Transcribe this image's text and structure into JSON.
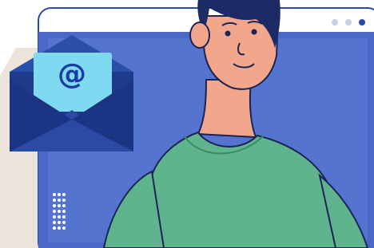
{
  "illustration": {
    "envelope_symbol": "@",
    "window_dots": 3,
    "decor_dot_rows": 7,
    "decor_dot_cols": 3
  },
  "colors": {
    "background": "#ffffff",
    "beige_panel": "#ece4da",
    "window_border": "#2d49a8",
    "window_fill": "#4a68c6",
    "window_dot_light": "#c9cde6",
    "window_dot_dark": "#2d49a8",
    "envelope_outer": "#1e3a8a",
    "envelope_flap": "#2a4fa8",
    "letter": "#7fd9f0",
    "at_sign": "#1c3aa3",
    "skin": "#f2a68b",
    "hair": "#1c2b66",
    "shirt": "#5fb48d",
    "outline": "#1a2553"
  },
  "icons": [
    "email-envelope-icon",
    "at-sign-icon",
    "window-dots-icon",
    "dot-grid-decoration"
  ]
}
